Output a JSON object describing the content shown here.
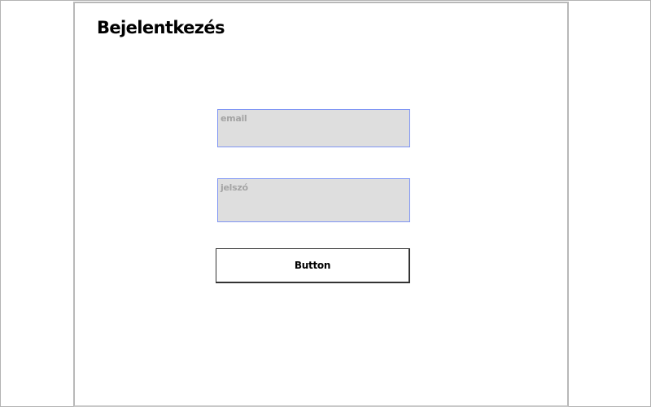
{
  "page": {
    "title": "Bejelentkezés"
  },
  "form": {
    "email_placeholder": "email",
    "email_value": "",
    "password_placeholder": "jelszó",
    "password_value": "",
    "submit_label": "Button"
  },
  "colors": {
    "field_background": "#dedede",
    "field_border": "#7f95f4",
    "placeholder_text": "#a4a4a4",
    "button_border": "#333333",
    "frame_border": "#b8b8b8"
  }
}
